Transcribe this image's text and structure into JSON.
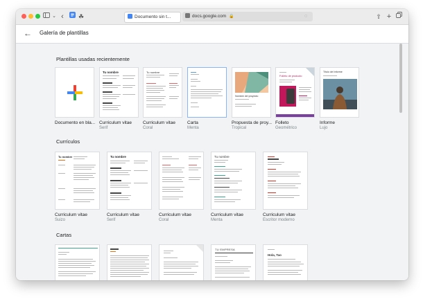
{
  "browser": {
    "tab_active": "Documento sin t...",
    "address": "docs.google.com",
    "colors": {
      "close": "#ff5f57",
      "minimize": "#febc2e",
      "zoom": "#28c840",
      "docs_blue": "#4285f4"
    }
  },
  "appbar": {
    "title": "Galería de plantillas"
  },
  "sections": {
    "recent": {
      "title": "Plantillas usadas recientemente",
      "items": [
        {
          "name": "Documento en bla...",
          "sub": ""
        },
        {
          "name": "Curriculum vitae",
          "sub": "Serif"
        },
        {
          "name": "Curriculum vitae",
          "sub": "Coral"
        },
        {
          "name": "Carta",
          "sub": "Menta"
        },
        {
          "name": "Propuesta de proy...",
          "sub": "Tropical"
        },
        {
          "name": "Folleto",
          "sub": "Geométrico"
        },
        {
          "name": "Informe",
          "sub": "Lujo"
        }
      ]
    },
    "cv": {
      "title": "Currículos",
      "items": [
        {
          "name": "Curriculum vitae",
          "sub": "Suizo"
        },
        {
          "name": "Curriculum vitae",
          "sub": "Serif"
        },
        {
          "name": "Curriculum vitae",
          "sub": "Coral"
        },
        {
          "name": "Curriculum vitae",
          "sub": "Menta"
        },
        {
          "name": "Curriculum vitae",
          "sub": "Escritor moderno"
        }
      ]
    },
    "letters": {
      "title": "Cartas",
      "items": [
        {
          "name": "",
          "sub": ""
        },
        {
          "name": "",
          "sub": ""
        },
        {
          "name": "",
          "sub": ""
        },
        {
          "name": "",
          "sub": ""
        },
        {
          "name": "",
          "sub": ""
        }
      ]
    }
  },
  "thumb_text": {
    "serif_heading": "Tu nombre",
    "coral_heading": "Tu nombre",
    "proposal_heading": "Nombre del proyecto",
    "brochure_heading": "Folleto de producto",
    "report_heading": "Título del informe",
    "cv_suizo_heading": "Tu nombre",
    "cv_serif_heading": "Tu nombre",
    "cv_menta_heading": "Tu nombre",
    "letter_company": "TU EMPRESA",
    "letter_greeting": "Hola, Tao"
  }
}
